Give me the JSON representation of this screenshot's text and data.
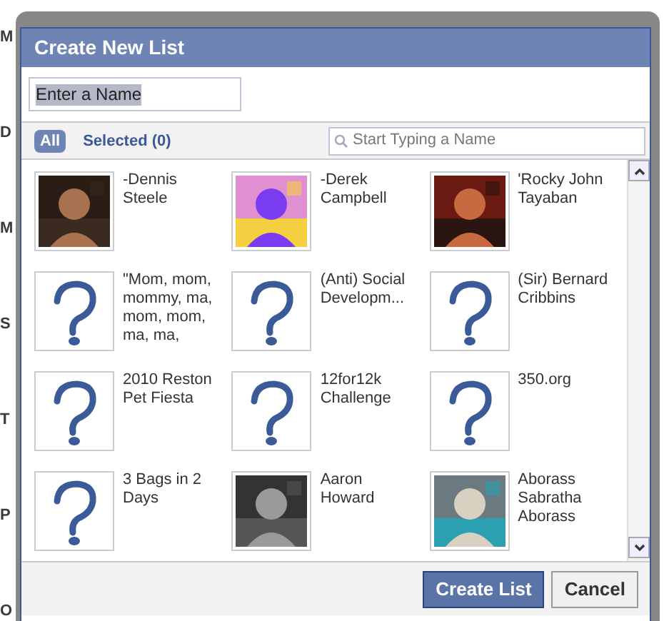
{
  "background": {
    "labels": [
      "M",
      "D",
      "M",
      "S",
      "T",
      "P",
      "O"
    ]
  },
  "dialog": {
    "title": "Create New List",
    "name_field": {
      "value": "Enter a Name"
    },
    "tabs": [
      {
        "label": "All",
        "selected": true
      },
      {
        "label": "Selected (0)",
        "selected": false
      }
    ],
    "search": {
      "placeholder": "Start Typing a Name"
    },
    "people": [
      {
        "name": "-Dennis Steele"
      },
      {
        "name": "-Derek Campbell"
      },
      {
        "name": "'Rocky John Tayaban"
      },
      {
        "name": "\"Mom, mom, mommy, ma, mom, mom, ma, ma,",
        "kind": "placeholder"
      },
      {
        "name": "(Anti) Social Developm...",
        "kind": "placeholder"
      },
      {
        "name": "(Sir) Bernard Cribbins",
        "kind": "placeholder"
      },
      {
        "name": "2010 Reston Pet Fiesta",
        "kind": "placeholder"
      },
      {
        "name": "12for12k Challenge",
        "kind": "placeholder"
      },
      {
        "name": "350.org",
        "kind": "placeholder"
      },
      {
        "name": "3 Bags in 2 Days",
        "kind": "placeholder"
      },
      {
        "name": "Aaron Howard"
      },
      {
        "name": "Aborass Sabratha Aborass"
      }
    ],
    "buttons": [
      {
        "label": "Create List",
        "kind": "primary"
      },
      {
        "label": "Cancel",
        "kind": "secondary"
      }
    ]
  }
}
